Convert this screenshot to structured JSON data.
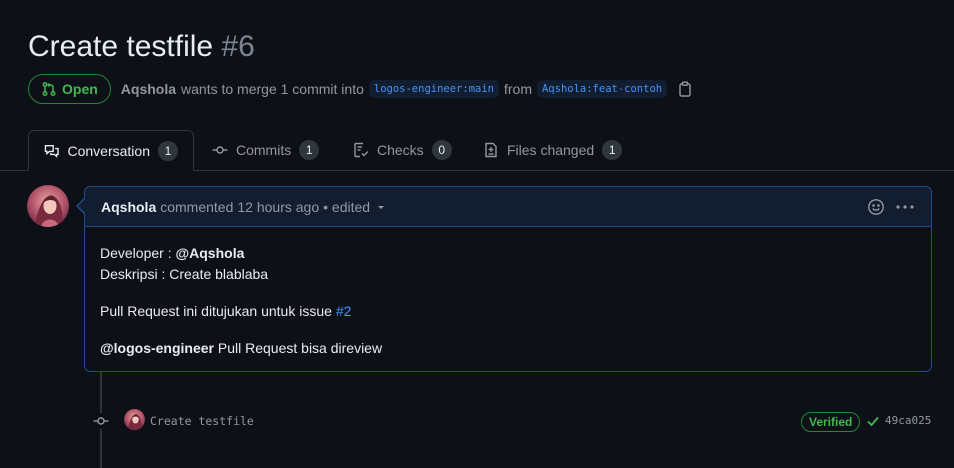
{
  "pr": {
    "title": "Create testfile",
    "number": "#6",
    "state": "Open",
    "author": "Aqshola",
    "merge_text": "wants to merge 1 commit into",
    "base_branch": "logos-engineer:main",
    "from_text": "from",
    "head_branch": "Aqshola:feat-contoh"
  },
  "tabs": [
    {
      "label": "Conversation",
      "count": "1",
      "icon": "comment-discussion-icon"
    },
    {
      "label": "Commits",
      "count": "1",
      "icon": "git-commit-icon"
    },
    {
      "label": "Checks",
      "count": "0",
      "icon": "checklist-icon"
    },
    {
      "label": "Files changed",
      "count": "1",
      "icon": "file-diff-icon"
    }
  ],
  "comment": {
    "author": "Aqshola",
    "action": "commented",
    "time": "12 hours ago",
    "edited": "• edited",
    "body": {
      "developer_label": "Developer : ",
      "developer_mention": "@Aqshola",
      "description": "Deskripsi : Create blablaba",
      "issue_text": "Pull Request ini ditujukan untuk issue ",
      "issue_link": "#2",
      "review_mention": "@logos-engineer",
      "review_text": " Pull Request bisa direview"
    }
  },
  "commit": {
    "message": "Create testfile",
    "verified": "Verified",
    "sha": "49ca025"
  },
  "colors": {
    "background": "#0d1117",
    "open_green": "#3fb950",
    "link_blue": "#4493f8",
    "highlight_border": "#1f4b8f"
  }
}
